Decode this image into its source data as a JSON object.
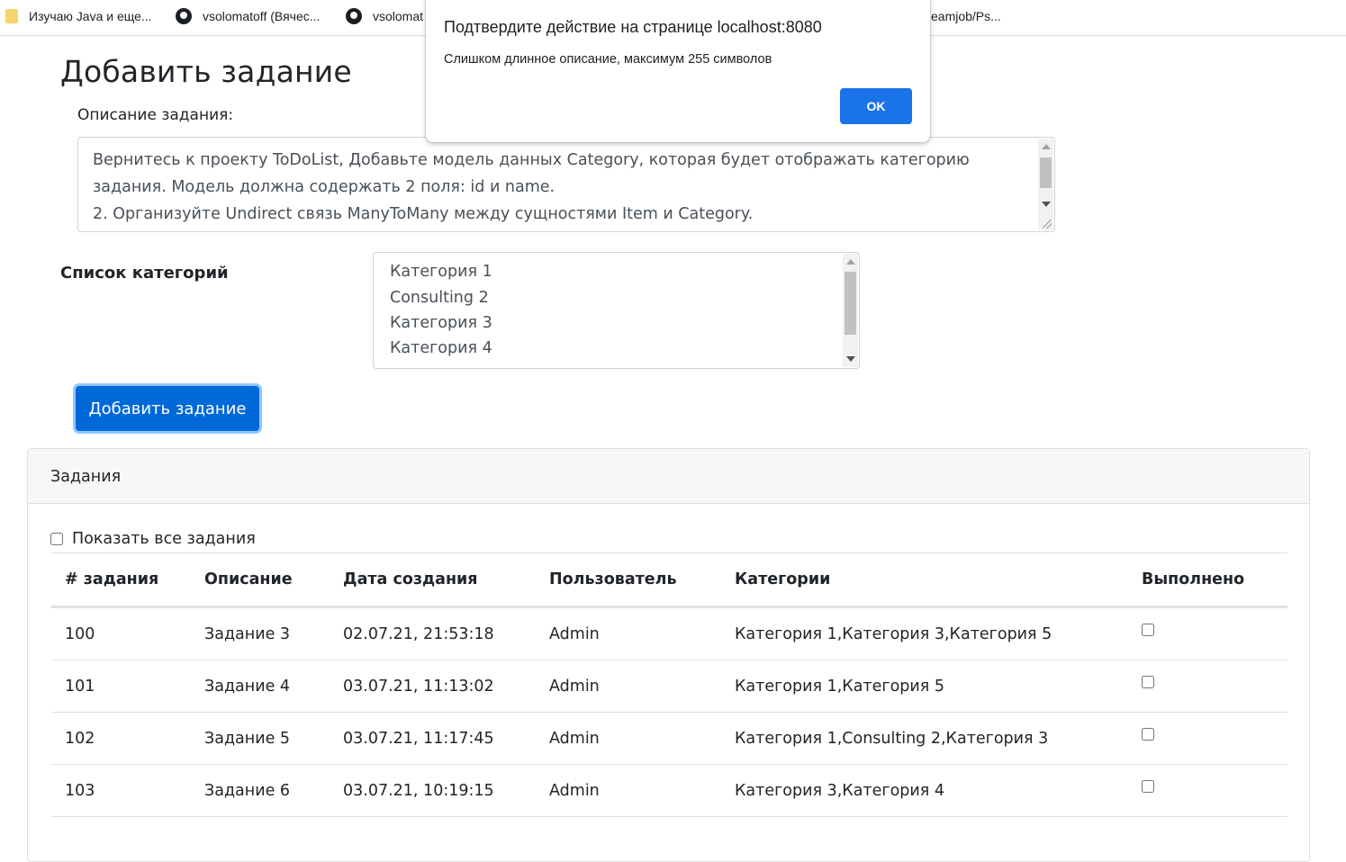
{
  "bookmarks": [
    {
      "label": "Изучаю Java и еще...",
      "icon": "folder-icon"
    },
    {
      "label": "vsolomatoff (Вячес...",
      "icon": "github-icon"
    },
    {
      "label": "vsolomat",
      "icon": "github-icon"
    },
    {
      "label": "eamjob/Ps...",
      "icon": ""
    }
  ],
  "page": {
    "title": "Добавить задание",
    "description_label": "Описание задания:",
    "description_value": "Вернитесь к проекту ToDoList, Добавьте модель данных Category, которая будет отображать категорию задания. Модель должна содержать 2 поля: id и name.\n2. Организуйте Undirect связь ManyToMany между сущностями Item и Category.",
    "categories_label": "Список категорий",
    "categories": [
      "Категория 1",
      "Consulting 2",
      "Категория 3",
      "Категория 4"
    ],
    "add_button": "Добавить задание"
  },
  "tasks_card": {
    "title": "Задания",
    "show_all_label": "Показать все задания",
    "show_all_checked": false,
    "columns": [
      "# задания",
      "Описание",
      "Дата создания",
      "Пользователь",
      "Категории",
      "Выполнено"
    ],
    "rows": [
      {
        "id": "100",
        "description": "Задание 3",
        "created": "02.07.21, 21:53:18",
        "user": "Admin",
        "categories": "Категория 1,Категория 3,Категория 5",
        "done": false
      },
      {
        "id": "101",
        "description": "Задание 4",
        "created": "03.07.21, 11:13:02",
        "user": "Admin",
        "categories": "Категория 1,Категория 5",
        "done": false
      },
      {
        "id": "102",
        "description": "Задание 5",
        "created": "03.07.21, 11:17:45",
        "user": "Admin",
        "categories": "Категория 1,Consulting 2,Категория 3",
        "done": false
      },
      {
        "id": "103",
        "description": "Задание 6",
        "created": "03.07.21, 10:19:15",
        "user": "Admin",
        "categories": "Категория 3,Категория 4",
        "done": false
      }
    ]
  },
  "dialog": {
    "title": "Подтвердите действие на странице localhost:8080",
    "message": "Слишком длинное описание, максимум 255 символов",
    "ok_label": "OK"
  },
  "colors": {
    "primary_button": "#0069d9",
    "dialog_button": "#1a73e8",
    "card_header": "#f7f7f7"
  }
}
